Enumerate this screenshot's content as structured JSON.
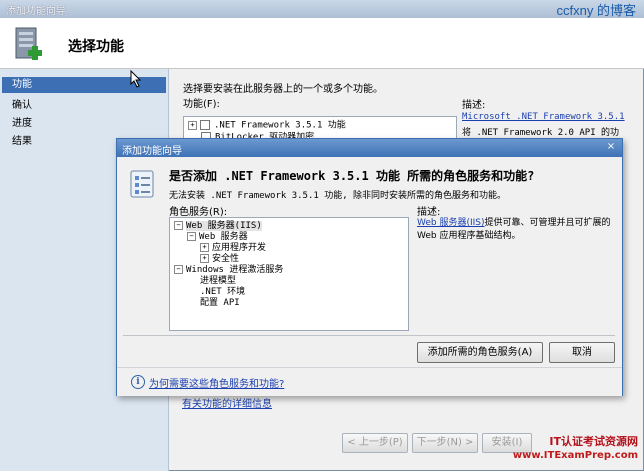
{
  "window": {
    "title": "添加功能向导",
    "watermark_top": "ccfxny 的博客"
  },
  "header": {
    "title": "选择功能",
    "icon": "server-add-icon"
  },
  "sidebar": {
    "items": [
      {
        "label": "功能",
        "active": true
      },
      {
        "label": "确认",
        "active": false
      },
      {
        "label": "进度",
        "active": false
      },
      {
        "label": "结果",
        "active": false
      }
    ]
  },
  "main": {
    "instruction": "选择要安装在此服务器上的一个或多个功能。",
    "features_label": "功能(F):",
    "features": [
      {
        "label": ".NET Framework 3.5.1 功能",
        "expander": "+"
      },
      {
        "label": "BitLocker 驱动器加密",
        "expander": ""
      }
    ],
    "desc_label": "描述:",
    "desc_link": "Microsoft .NET Framework 3.5.1",
    "desc_text": "将 .NET Framework 2.0 API 的功",
    "more_info_link": "有关功能的详细信息"
  },
  "nav_buttons": {
    "prev": "< 上一步(P)",
    "next": "下一步(N) >",
    "install": "安装(I)"
  },
  "watermark_bottom": {
    "line1": "IT认证考试资源网",
    "line2": "www.ITExamPrep.com"
  },
  "dialog": {
    "title": "添加功能向导",
    "close": "×",
    "heading": "是否添加 .NET Framework 3.5.1 功能 所需的角色服务和功能?",
    "sub": "无法安装 .NET Framework 3.5.1 功能, 除非同时安装所需的角色服务和功能。",
    "role_label": "角色服务(R):",
    "tree": [
      {
        "label": "Web 服务器(IIS)",
        "expander": "−",
        "level": 0
      },
      {
        "label": "Web 服务器",
        "expander": "−",
        "level": 1
      },
      {
        "label": "应用程序开发",
        "expander": "+",
        "level": 2
      },
      {
        "label": "安全性",
        "expander": "+",
        "level": 2
      },
      {
        "label": "Windows 进程激活服务",
        "expander": "−",
        "level": 0
      },
      {
        "label": "进程模型",
        "expander": "",
        "level": 1
      },
      {
        "label": ".NET 环境",
        "expander": "",
        "level": 1
      },
      {
        "label": "配置 API",
        "expander": "",
        "level": 1
      }
    ],
    "desc_label": "描述:",
    "desc_link": "Web 服务器(IIS)",
    "desc_text": "提供可靠、可管理并且可扩展的 Web 应用程序基础结构。",
    "add_button": "添加所需的角色服务(A)",
    "cancel_button": "取消",
    "why_link": "为何需要这些角色服务和功能?",
    "info_icon": "info-icon"
  },
  "colors": {
    "dialog_titlebar": "#3f72b6",
    "link": "#1a3fae",
    "sidebar_active": "#3c6fb3"
  }
}
